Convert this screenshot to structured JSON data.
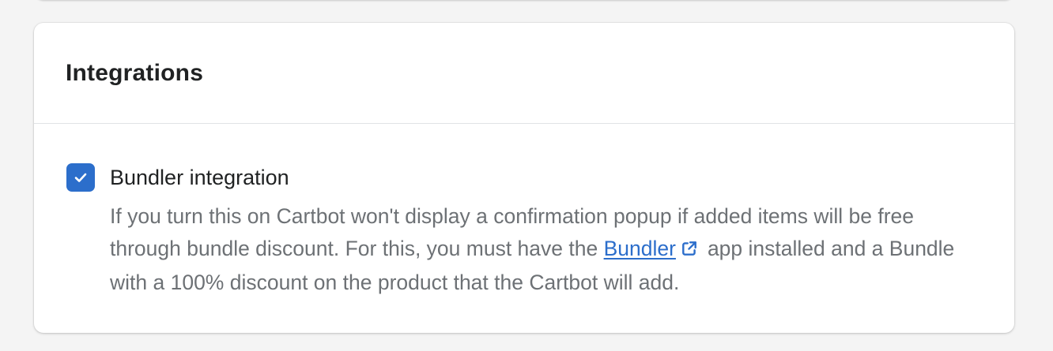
{
  "card": {
    "title": "Integrations"
  },
  "bundler_setting": {
    "checked": true,
    "label": "Bundler integration",
    "help_before_link": "If you turn this on Cartbot won't display a confirmation popup if added items will be free through bundle discount. For this, you must have the ",
    "link_text": "Bundler",
    "help_after_link": "app installed and a Bundle with a 100% discount on the product that the Cartbot will add."
  },
  "icons": {
    "checkbox": "checkmark-icon",
    "link": "external-link-icon"
  },
  "colors": {
    "accent": "#2c6ecb",
    "background": "#f4f4f4",
    "card": "#ffffff",
    "help_text": "#6d7175"
  }
}
